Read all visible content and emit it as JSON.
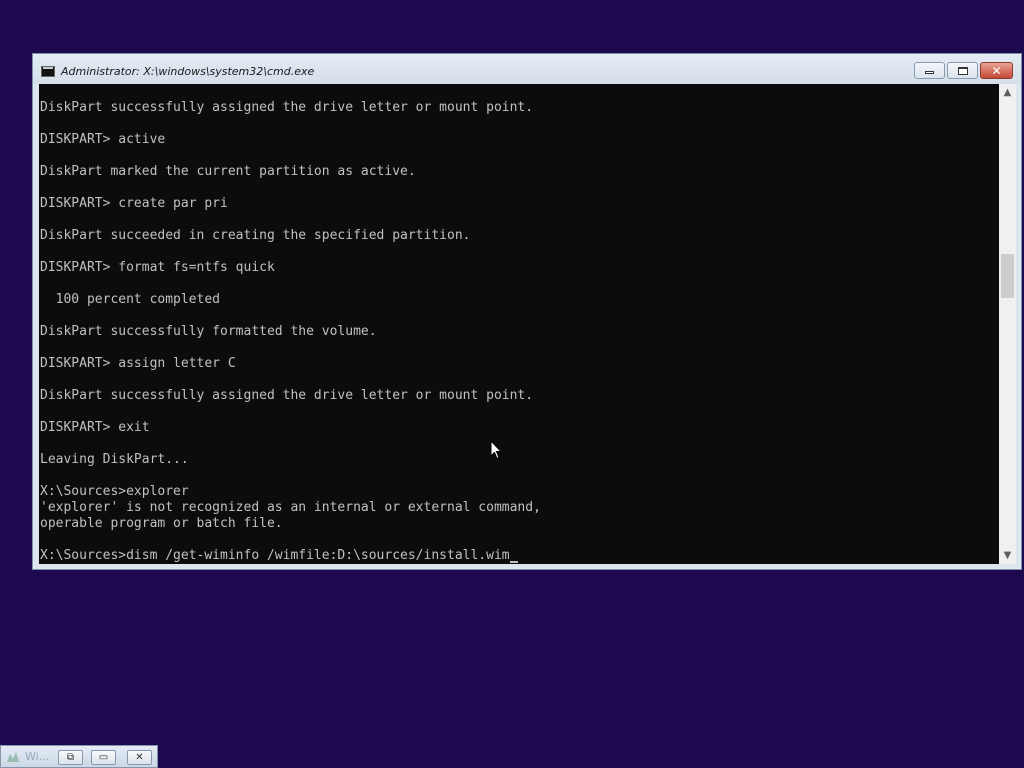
{
  "window": {
    "title": "Administrator: X:\\windows\\system32\\cmd.exe",
    "close_glyph": "✕"
  },
  "console": {
    "lines": [
      "DiskPart successfully assigned the drive letter or mount point.",
      "",
      "DISKPART> active",
      "",
      "DiskPart marked the current partition as active.",
      "",
      "DISKPART> create par pri",
      "",
      "DiskPart succeeded in creating the specified partition.",
      "",
      "DISKPART> format fs=ntfs quick",
      "",
      "  100 percent completed",
      "",
      "DiskPart successfully formatted the volume.",
      "",
      "DISKPART> assign letter C",
      "",
      "DiskPart successfully assigned the drive letter or mount point.",
      "",
      "DISKPART> exit",
      "",
      "Leaving DiskPart...",
      "",
      "X:\\Sources>explorer",
      "'explorer' is not recognized as an internal or external command,",
      "operable program or batch file.",
      "",
      "X:\\Sources>dism /get-wiminfo /wimfile:D:\\sources/install.wim"
    ],
    "text_color": "#c0c0c0",
    "background": "#0c0c0c"
  },
  "scrollbar": {
    "up_glyph": "▲",
    "down_glyph": "▼",
    "position": 0.38
  },
  "taskbar": {
    "title": "Wi...",
    "restore_glyph": "⧉",
    "max_glyph": "▭",
    "close_glyph": "✕"
  },
  "desktop": {
    "background": "#1c0950"
  },
  "icons": {
    "window_icon": "cmd-icon",
    "pointer": "mouse-pointer-icon",
    "task_icon": "setup-icon"
  }
}
